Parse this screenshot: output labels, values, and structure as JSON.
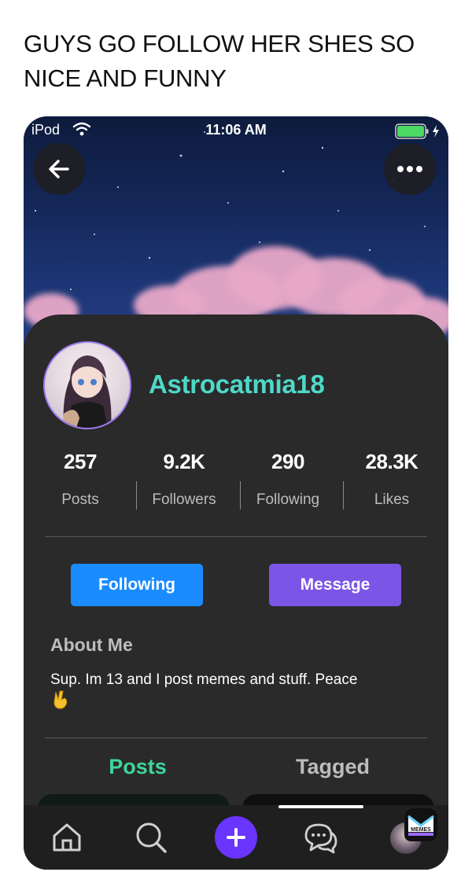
{
  "caption": "GUYS GO FOLLOW HER SHES SO NICE AND FUNNY",
  "status_bar": {
    "carrier": "iPod",
    "time": "11:06 AM",
    "icons": [
      "wifi-icon",
      "battery-icon"
    ]
  },
  "header": {
    "back_icon": "back-arrow-icon",
    "more_icon": "more-icon"
  },
  "profile": {
    "username": "Astrocatmia18",
    "username_color": "#4ed8c8",
    "stats": [
      {
        "value": "257",
        "label": "Posts"
      },
      {
        "value": "9.2K",
        "label": "Followers"
      },
      {
        "value": "290",
        "label": "Following"
      },
      {
        "value": "28.3K",
        "label": "Likes"
      }
    ]
  },
  "actions": {
    "following_label": "Following",
    "message_label": "Message",
    "following_color": "#1a8cff",
    "message_color": "#7b55e6"
  },
  "about": {
    "title": "About Me",
    "text": "Sup. Im 13 and I post memes and stuff.  Peace"
  },
  "tabs": [
    {
      "label": "Posts",
      "active": true,
      "color": "#3ed59d"
    },
    {
      "label": "Tagged",
      "active": false
    }
  ],
  "bottom_nav": {
    "items": [
      "home-icon",
      "search-icon",
      "plus-icon",
      "messages-icon",
      "profile-avatar"
    ],
    "plus_color": "#6a35ff"
  },
  "watermark": {
    "text": "MEMES"
  }
}
